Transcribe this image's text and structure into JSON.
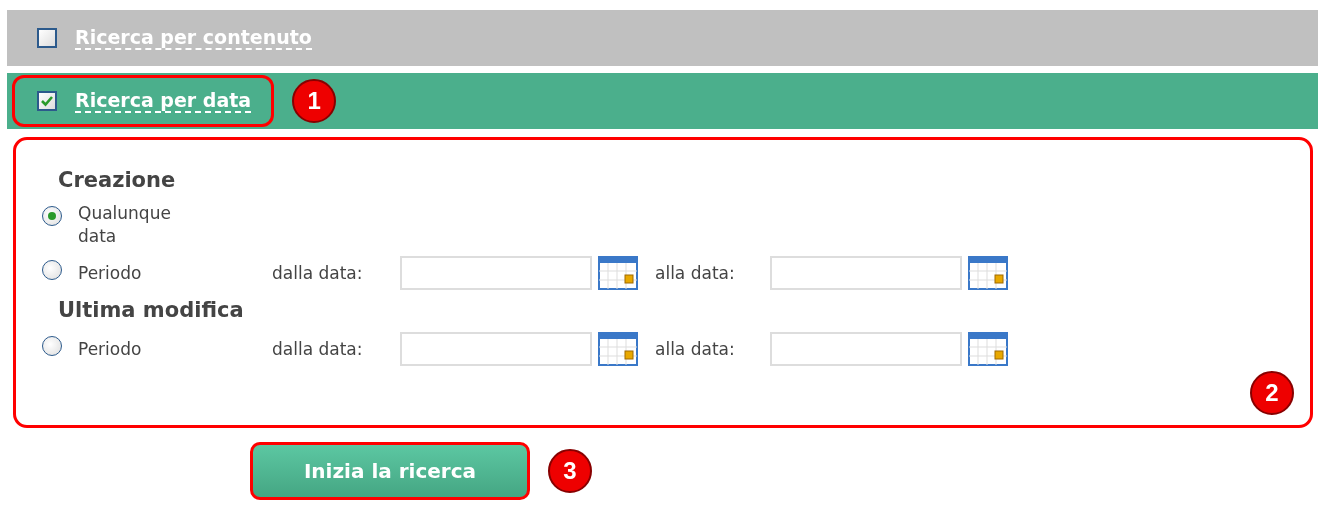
{
  "sections": [
    {
      "label": "Ricerca per contenuto",
      "checked": false
    },
    {
      "label": "Ricerca per data",
      "checked": true,
      "callout": "1"
    }
  ],
  "groups": [
    {
      "title": "Creazione",
      "options": [
        {
          "kind": "any",
          "label": "Qualunque data",
          "selected": true
        },
        {
          "kind": "period",
          "label": "Periodo",
          "selected": false,
          "from_label": "dalla data:",
          "to_label": "alla data:"
        }
      ]
    },
    {
      "title": "Ultima modifica",
      "options": [
        {
          "kind": "period",
          "label": "Periodo",
          "selected": false,
          "from_label": "dalla data:",
          "to_label": "alla data:"
        }
      ]
    }
  ],
  "panel_callout": "2",
  "button": {
    "label": "Inizia la ricerca",
    "callout": "3"
  }
}
